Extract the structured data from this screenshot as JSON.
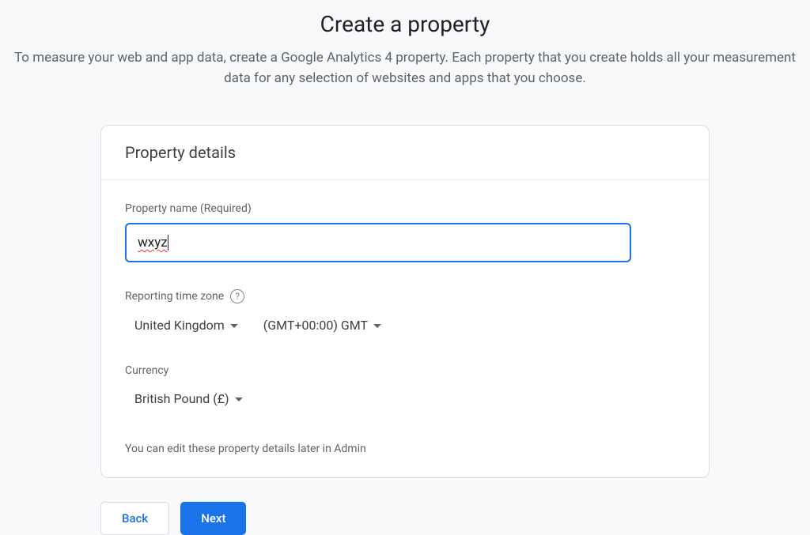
{
  "page": {
    "title": "Create a property",
    "description": "To measure your web and app data, create a Google Analytics 4 property. Each property that you create holds all your measurement data for any selection of websites and apps that you choose."
  },
  "card": {
    "title": "Property details",
    "propertyName": {
      "label": "Property name (Required)",
      "value": "wxyz"
    },
    "timezone": {
      "label": "Reporting time zone",
      "country": "United Kingdom",
      "offset": "(GMT+00:00) GMT"
    },
    "currency": {
      "label": "Currency",
      "value": "British Pound (£)"
    },
    "note": "You can edit these property details later in Admin"
  },
  "buttons": {
    "back": "Back",
    "next": "Next"
  }
}
